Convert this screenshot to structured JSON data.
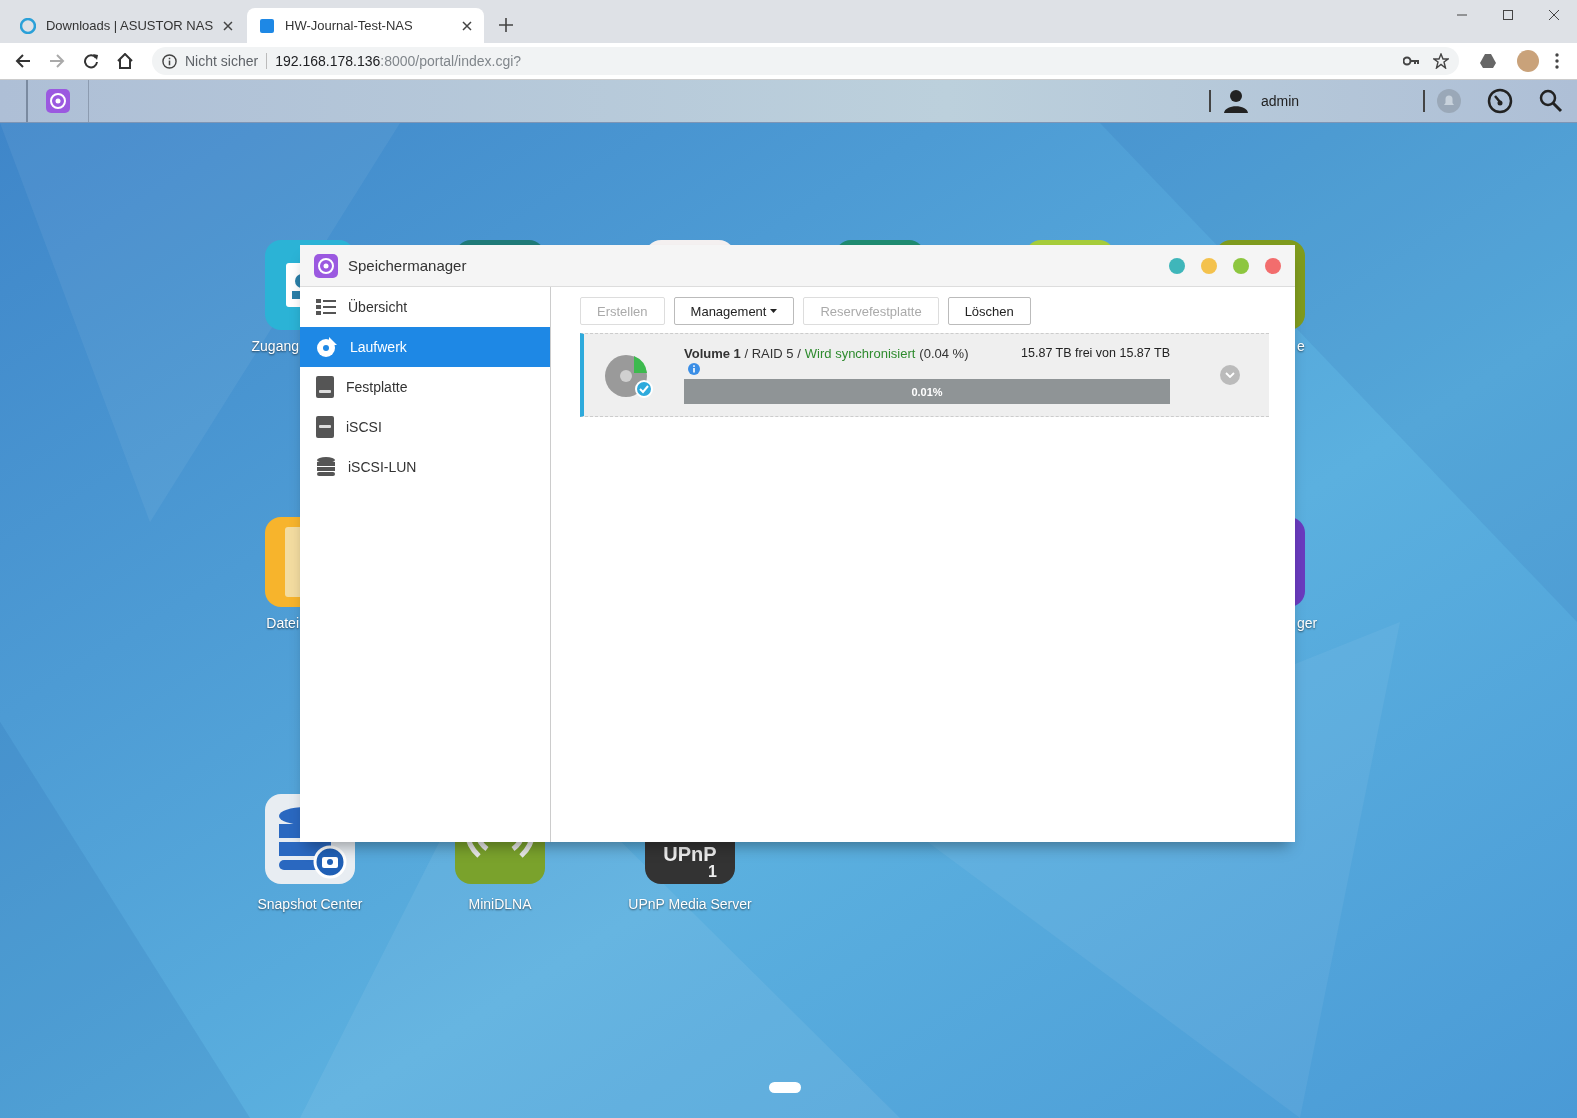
{
  "browser": {
    "tabs": [
      {
        "title": "Downloads | ASUSTOR NAS",
        "selected": false
      },
      {
        "title": "HW-Journal-Test-NAS",
        "selected": true
      }
    ],
    "security": "Nicht sicher",
    "url_host": "192.168.178.136",
    "url_path": ":8000/portal/index.cgi?"
  },
  "nas_bar": {
    "user": "admin"
  },
  "desktop_icons": [
    {
      "color": "#2bb3d6",
      "label": "Zugang"
    },
    {
      "color": "#1f7a78"
    },
    {
      "color": "#f4f0f0"
    },
    {
      "color": "#1f8a70"
    },
    {
      "color": "#a6cc3a"
    },
    {
      "color": "#7f9b1e",
      "label": "e"
    },
    {
      "color": "#f7b42c",
      "label": "Datei"
    },
    {
      "color": "#6a3bbf",
      "label": "ger"
    },
    {
      "color": "#e8edf2",
      "label": "Snapshot Center"
    },
    {
      "color": "#7aa22c",
      "label": "MiniDLNA"
    },
    {
      "color": "#333333",
      "label": "UPnP Media Server",
      "icon_text": [
        "UPnP",
        "1"
      ]
    }
  ],
  "window": {
    "title": "Speichermanager",
    "controls": [
      {
        "color": "#3fb6ba"
      },
      {
        "color": "#f4c24d"
      },
      {
        "color": "#8dc63f"
      },
      {
        "color": "#f26d6d"
      }
    ],
    "sidebar": [
      {
        "label": "Übersicht",
        "selected": false
      },
      {
        "label": "Laufwerk",
        "selected": true
      },
      {
        "label": "Festplatte",
        "selected": false
      },
      {
        "label": "iSCSI",
        "selected": false
      },
      {
        "label": "iSCSI-LUN",
        "selected": false
      }
    ],
    "toolbar": [
      {
        "label": "Erstellen",
        "kind": "button",
        "disabled": true
      },
      {
        "label": "Management",
        "kind": "dropdown",
        "disabled": false
      },
      {
        "label": "Reservefestplatte",
        "kind": "button",
        "disabled": true
      },
      {
        "label": "Löschen",
        "kind": "button",
        "disabled": false
      }
    ],
    "volumes": [
      {
        "title": "**Volume 1** / RAID 5 /",
        "status": "Wird synchronisiert",
        "note": "(0.04 %)",
        "capacity": "15.87 TB frei von 15.87 TB",
        "level": 0.0001,
        "progress": "0.01%"
      }
    ]
  }
}
